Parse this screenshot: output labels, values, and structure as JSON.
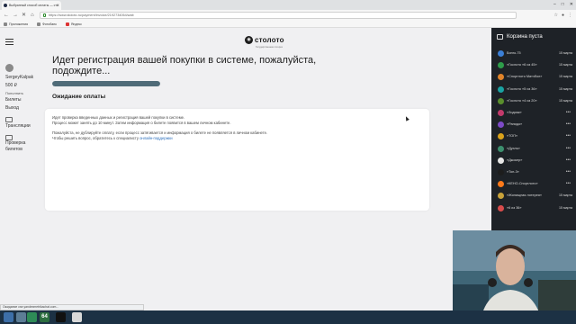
{
  "browser": {
    "tab_title": "Выбранный способ оплаты — сто",
    "url": "https://www.stoloto.ru/payment/invoice/2192734064/wait",
    "bookmarks": [
      "Приложения",
      "Фотобанк",
      "Яндекс"
    ]
  },
  "header": {
    "logo_text": "столото",
    "logo_sub": "Государственная лотерея"
  },
  "sidebar": {
    "username": "SergeyKalpak",
    "balance": "500 ₽",
    "topup": "Пополнить",
    "items": [
      "Билеты",
      "Выход",
      "Трансляции",
      "Проверка билетов"
    ]
  },
  "main": {
    "heading": "Идет регистрация вашей покупки в системе, пожалуйста, подождите...",
    "progress": 1.0,
    "status_title": "Ожидание оплаты",
    "info_line1": "Идет проверка введенных данных и регистрация вашей покупки в системе.",
    "info_line2": "Процесс может занять до 10 минут. Затем информация о билете появится в вашем личном кабинете.",
    "warn_line1": "Пожалуйста, не дублируйте оплату, если процесс затягивается и информация о билете не появляется в личном кабинете.",
    "warn_line2_prefix": "Чтобы решить вопрос, обратитесь к специалисту",
    "support_link": "онлайн-поддержки"
  },
  "cart": {
    "title": "Корзина пуста",
    "lotteries": [
      {
        "name": "Бинго-75",
        "date": "15 марта",
        "color": "#3b7fd6"
      },
      {
        "name": "«Гослото «6 из 45»",
        "date": "15 марта",
        "color": "#2e9d4a"
      },
      {
        "name": "«Спортлото Матчбол»",
        "date": "15 марта",
        "color": "#e0842a"
      },
      {
        "name": "«Гослото «5 из 36»",
        "date": "15 марта",
        "color": "#1aa3a3"
      },
      {
        "name": "«Гослото «4 из 20»",
        "date": "15 марта",
        "color": "#5a8f2d"
      },
      {
        "name": "«Зодиак»",
        "date": "",
        "color": "#c33a6b"
      },
      {
        "name": "«Рапидо»",
        "date": "",
        "color": "#7d4ac7"
      },
      {
        "name": "«ТОП»",
        "date": "",
        "color": "#d9a21b"
      },
      {
        "name": "«Дуэль»",
        "date": "",
        "color": "#3c8f6e"
      },
      {
        "name": "«Джокер»",
        "date": "",
        "color": "#e6e6e6"
      },
      {
        "name": "«Топ-3»",
        "date": "",
        "color": "#1d1d1d"
      },
      {
        "name": "«КЕНО-Спортлото»",
        "date": "",
        "color": "#ff7a1a"
      },
      {
        "name": "«Жилищная лотерея»",
        "date": "15 марта",
        "color": "#c9a23a"
      },
      {
        "name": "«6 из 36»",
        "date": "15 марта",
        "color": "#d84c4c"
      }
    ]
  },
  "statusbar": {
    "text": "Ожидание cse.yandexmetrikachat.com..."
  },
  "taskbar": {
    "badge": "64"
  }
}
